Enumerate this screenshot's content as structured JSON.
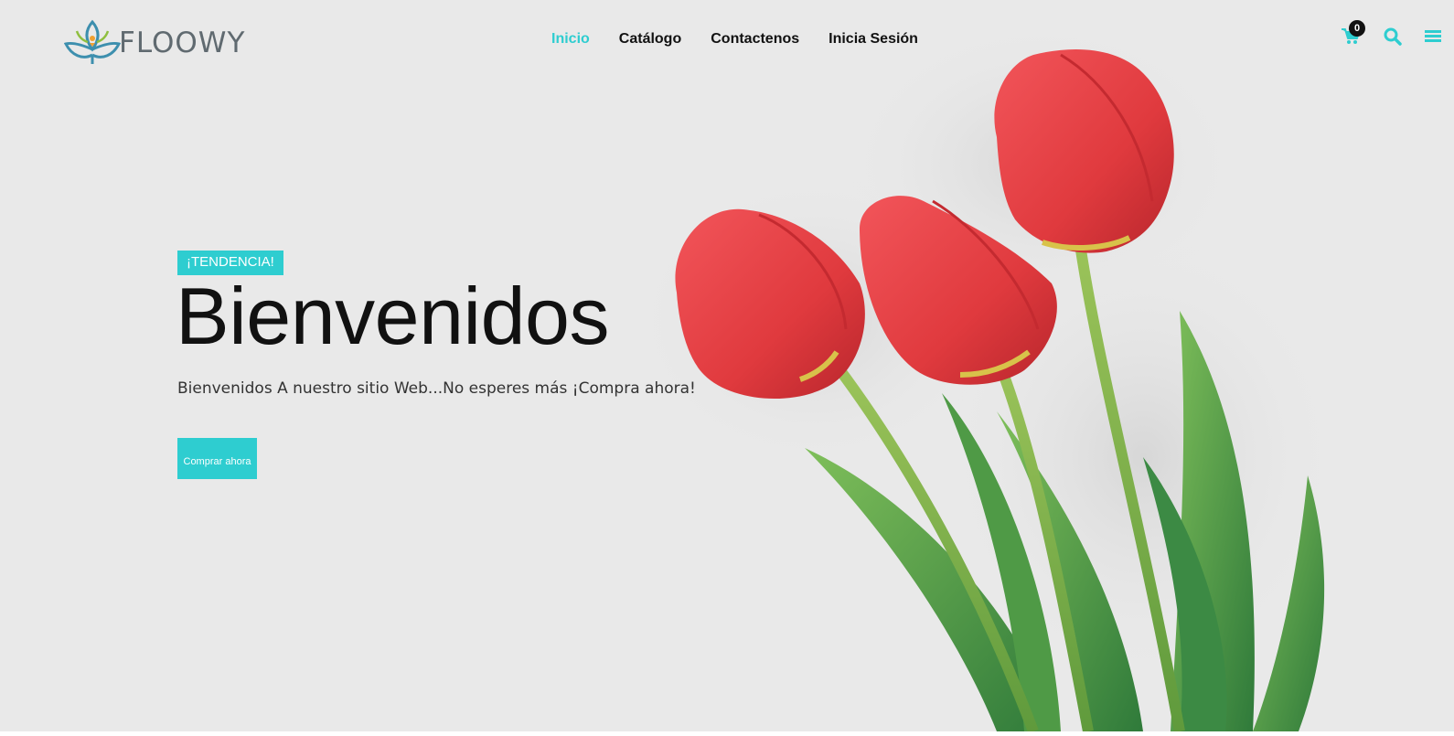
{
  "brand": {
    "name": "FLOOWY",
    "accent": "#2ecdd0"
  },
  "nav": [
    {
      "label": "Inicio",
      "active": true
    },
    {
      "label": "Catálogo",
      "active": false
    },
    {
      "label": "Contactenos",
      "active": false
    },
    {
      "label": "Inicia Sesión",
      "active": false
    }
  ],
  "header_icons": {
    "cart": "shopping-cart-icon",
    "search": "search-icon",
    "menu": "hamburger-menu-icon"
  },
  "cart": {
    "count": "0"
  },
  "hero": {
    "tag": "¡TENDENCIA!",
    "title": "Bienvenidos",
    "subtitle": "Bienvenidos A nuestro sitio Web...No esperes más ¡Compra ahora!",
    "cta_label": "Comprar ahora",
    "image": "red-tulips-bouquet"
  }
}
